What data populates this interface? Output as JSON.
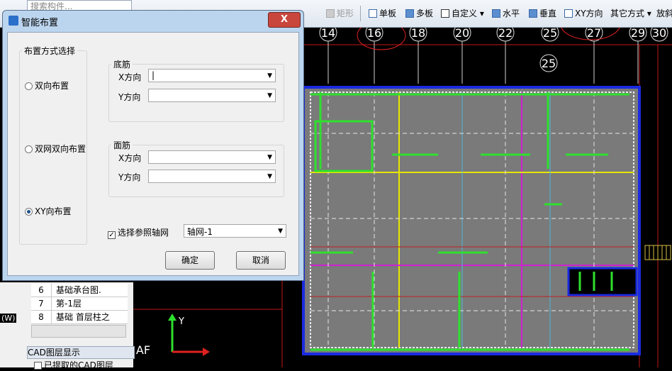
{
  "toolbar": {
    "search_placeholder": "搜索构件...",
    "greyed_label": "矩形",
    "single_board": "单板",
    "multi_board": "多板",
    "custom": "自定义",
    "horizontal": "水平",
    "vertical": "垂直",
    "xy_direction": "XY方向",
    "other_methods": "其它方式",
    "place": "放斜"
  },
  "axes": {
    "top_labels": [
      "14",
      "16",
      "18",
      "20",
      "22",
      "25",
      "27",
      "29",
      "30"
    ],
    "inner_label": "25",
    "side_label": "AF",
    "y_arrow_label": "Y",
    "w_label": "(W)"
  },
  "dialog": {
    "title": "智能布置",
    "close": "X",
    "layout_group": "布置方式选择",
    "options": [
      "双向布置",
      "双网双向布置",
      "XY向布置"
    ],
    "selected_index": 2,
    "bottom_group": "底筋",
    "top_group": "面筋",
    "x_dir": "X方向",
    "y_dir": "Y方向",
    "ref_axis_label": "选择参照轴网",
    "ref_axis_value": "轴网-1",
    "ok": "确定",
    "cancel": "取消"
  },
  "layers": {
    "rows": [
      {
        "n": "6",
        "text": "基础承台图."
      },
      {
        "n": "7",
        "text": "第-1层"
      },
      {
        "n": "8",
        "text": "基础 首层柱之"
      }
    ],
    "panel_title": "CAD图层显示",
    "item": "已提取的CAD图层"
  },
  "colors": {
    "accent_red": "#e02020",
    "slab_grey": "#7a7a7a",
    "rebar_green": "#2ee02e"
  }
}
